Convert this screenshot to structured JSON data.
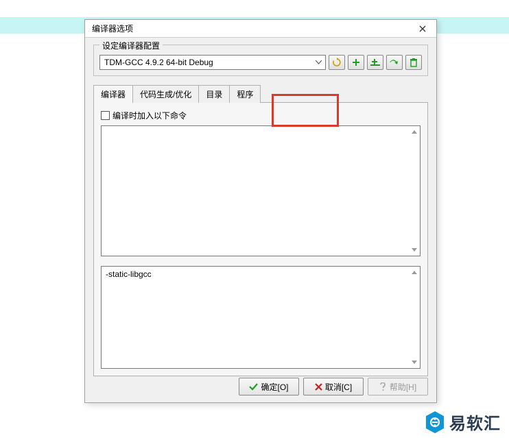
{
  "dialog": {
    "title": "编译器选项",
    "group_label": "设定编译器配置",
    "combo_value": "TDM-GCC 4.9.2 64-bit Debug"
  },
  "tabs": {
    "compiler": "编译器",
    "codegen": "代码生成/优化",
    "directories": "目录",
    "programs": "程序"
  },
  "checkbox_label": "编译时加入以下命令",
  "textarea2_value": "-static-libgcc",
  "buttons": {
    "ok": "确定[O]",
    "cancel": "取消[C]",
    "help": "帮助[H]"
  },
  "watermark": "易软汇",
  "icons": {
    "refresh": "refresh-icon",
    "add": "add-icon",
    "add_folder": "add-folder-icon",
    "rename": "rename-icon",
    "delete": "delete-icon"
  }
}
